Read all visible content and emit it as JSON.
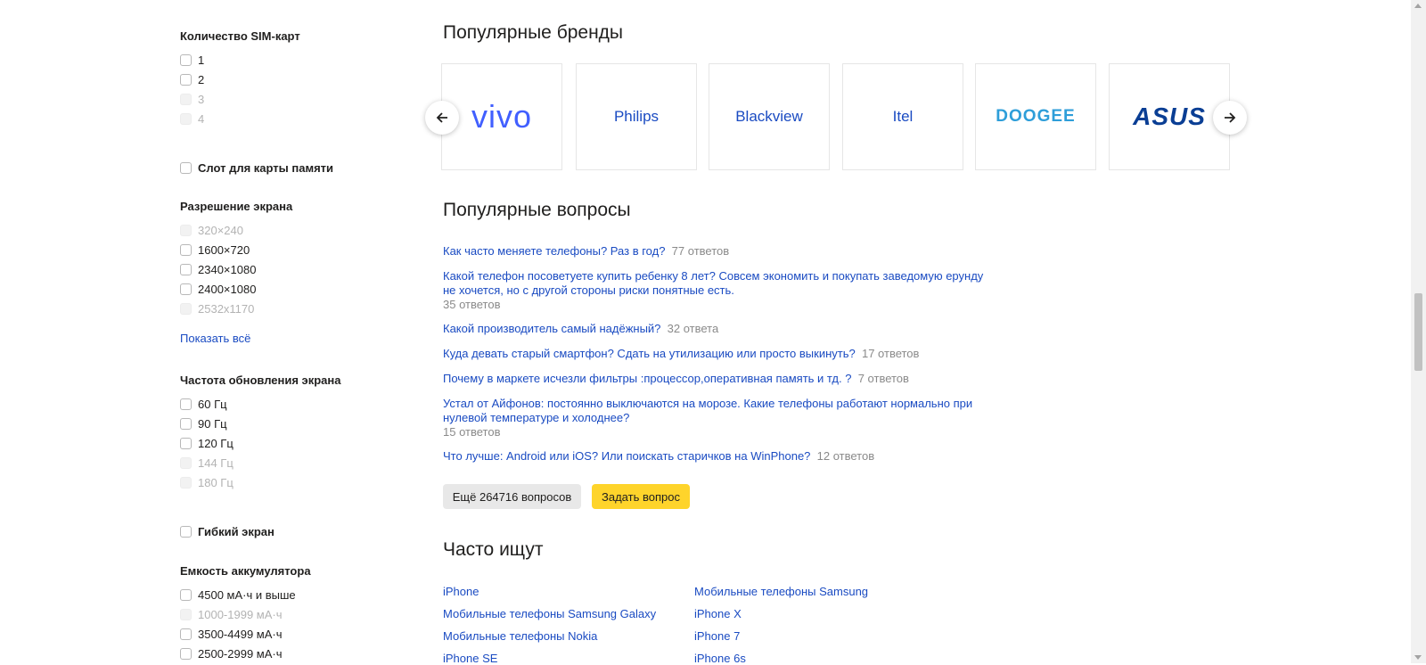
{
  "filters": {
    "sim": {
      "title": "Количество SIM-карт",
      "options": [
        {
          "label": "1",
          "disabled": false
        },
        {
          "label": "2",
          "disabled": false
        },
        {
          "label": "3",
          "disabled": true
        },
        {
          "label": "4",
          "disabled": true
        }
      ]
    },
    "memory_slot": {
      "label": "Слот для карты памяти"
    },
    "resolution": {
      "title": "Разрешение экрана",
      "options": [
        {
          "label": "320×240",
          "disabled": true
        },
        {
          "label": "1600×720",
          "disabled": false
        },
        {
          "label": "2340×1080",
          "disabled": false
        },
        {
          "label": "2400×1080",
          "disabled": false
        },
        {
          "label": "2532x1170",
          "disabled": true
        }
      ],
      "show_all": "Показать всё"
    },
    "refresh_rate": {
      "title": "Частота обновления экрана",
      "options": [
        {
          "label": "60 Гц",
          "disabled": false
        },
        {
          "label": "90 Гц",
          "disabled": false
        },
        {
          "label": "120 Гц",
          "disabled": false
        },
        {
          "label": "144 Гц",
          "disabled": true
        },
        {
          "label": "180 Гц",
          "disabled": true
        }
      ]
    },
    "flexible": {
      "label": "Гибкий экран"
    },
    "battery": {
      "title": "Емкость аккумулятора",
      "options": [
        {
          "label": "4500 мА·ч и выше",
          "disabled": false
        },
        {
          "label": "1000-1999 мА·ч",
          "disabled": true
        },
        {
          "label": "3500-4499 мА·ч",
          "disabled": false
        },
        {
          "label": "2500-2999 мА·ч",
          "disabled": false
        }
      ]
    }
  },
  "brands": {
    "title": "Популярные бренды",
    "items": [
      "vivo",
      "Philips",
      "Blackview",
      "Itel",
      "DOOGEE",
      "ASUS"
    ]
  },
  "questions": {
    "title": "Популярные вопросы",
    "items": [
      {
        "text": "Как часто меняете телефоны? Раз в год?",
        "count": "77 ответов"
      },
      {
        "text": "Какой телефон посоветуете купить ребенку 8 лет? Совсем экономить и покупать заведомую ерунду не хочется, но с другой стороны риски понятные есть.",
        "count": "35 ответов"
      },
      {
        "text": "Какой производитель самый надёжный?",
        "count": "32 ответа"
      },
      {
        "text": "Куда девать старый смартфон? Сдать на утилизацию или просто выкинуть?",
        "count": "17 ответов"
      },
      {
        "text": "Почему в маркете исчезли фильтры :процессор,оперативная память и тд. ?",
        "count": "7 ответов"
      },
      {
        "text": "Устал от Айфонов: постоянно выключаются на морозе. Какие телефоны работают нормально при нулевой температуре и холоднее?",
        "count": "15 ответов"
      },
      {
        "text": "Что лучше: Android или iOS? Или поискать старичков на WinPhone?",
        "count": "12 ответов"
      }
    ],
    "more_button": "Ещё 264716 вопросов",
    "ask_button": "Задать вопрос"
  },
  "frequent": {
    "title": "Часто ищут",
    "col1": [
      "iPhone",
      "Мобильные телефоны Samsung Galaxy",
      "Мобильные телефоны Nokia",
      "iPhone SE"
    ],
    "col2": [
      "Мобильные телефоны Samsung",
      "iPhone X",
      "iPhone 7",
      "iPhone 6s"
    ]
  },
  "colors": {
    "link": "#1a4bc2",
    "accent": "#fed42b"
  }
}
